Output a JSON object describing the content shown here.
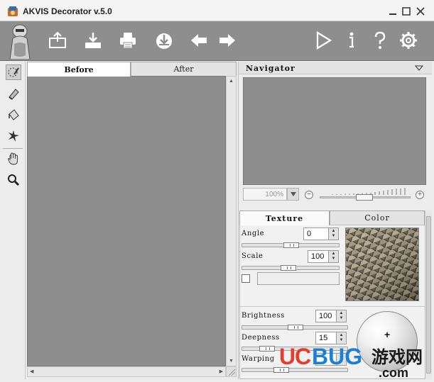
{
  "app": {
    "title": "AKVIS Decorator v.5.0"
  },
  "window_controls": {
    "minimize_glyph": "—",
    "maximize_glyph": "☐",
    "close_glyph": "✕"
  },
  "toolbar": {
    "icons": [
      "mascot-icon",
      "open-image-icon",
      "save-image-icon",
      "print-icon",
      "publish-icon",
      "undo-arrow-icon",
      "redo-arrow-icon",
      "run-icon",
      "info-icon",
      "help-icon",
      "settings-icon"
    ]
  },
  "tools": [
    "selection-brush-icon",
    "eraser-icon",
    "bucket-icon",
    "magic-wand-icon",
    "hand-icon",
    "zoom-icon"
  ],
  "view_tabs": [
    {
      "label": "Before",
      "active": true
    },
    {
      "label": "After",
      "active": false
    }
  ],
  "navigator": {
    "title": "Navigator",
    "zoom_value": "100%",
    "zoom_out_glyph": "−",
    "zoom_in_glyph": "+"
  },
  "panel_tabs": [
    {
      "label": "Texture",
      "active": true
    },
    {
      "label": "Color",
      "active": false
    }
  ],
  "params": {
    "angle": {
      "label": "Angle",
      "value": "0",
      "slider_fraction": 0.5
    },
    "scale": {
      "label": "Scale",
      "value": "100",
      "slider_fraction": 0.45
    },
    "brightness": {
      "label": "Brightness",
      "value": "100",
      "slider_fraction": 0.5
    },
    "deepness": {
      "label": "Deepness",
      "value": "15",
      "slider_fraction": 0.2
    },
    "warping": {
      "label": "Warping",
      "value": "",
      "slider_fraction": 0.35
    }
  },
  "watermark": {
    "brand_u": "U",
    "brand_c": "C",
    "brand_rest": "BUG",
    "cn": "游戏网",
    "domain": ".com"
  },
  "colors": {
    "toolbar_bg": "#8e8e8e",
    "canvas_bg": "#8e8e8e",
    "watermark_blue": "#1a7fd6",
    "watermark_red": "#e43d2a"
  }
}
